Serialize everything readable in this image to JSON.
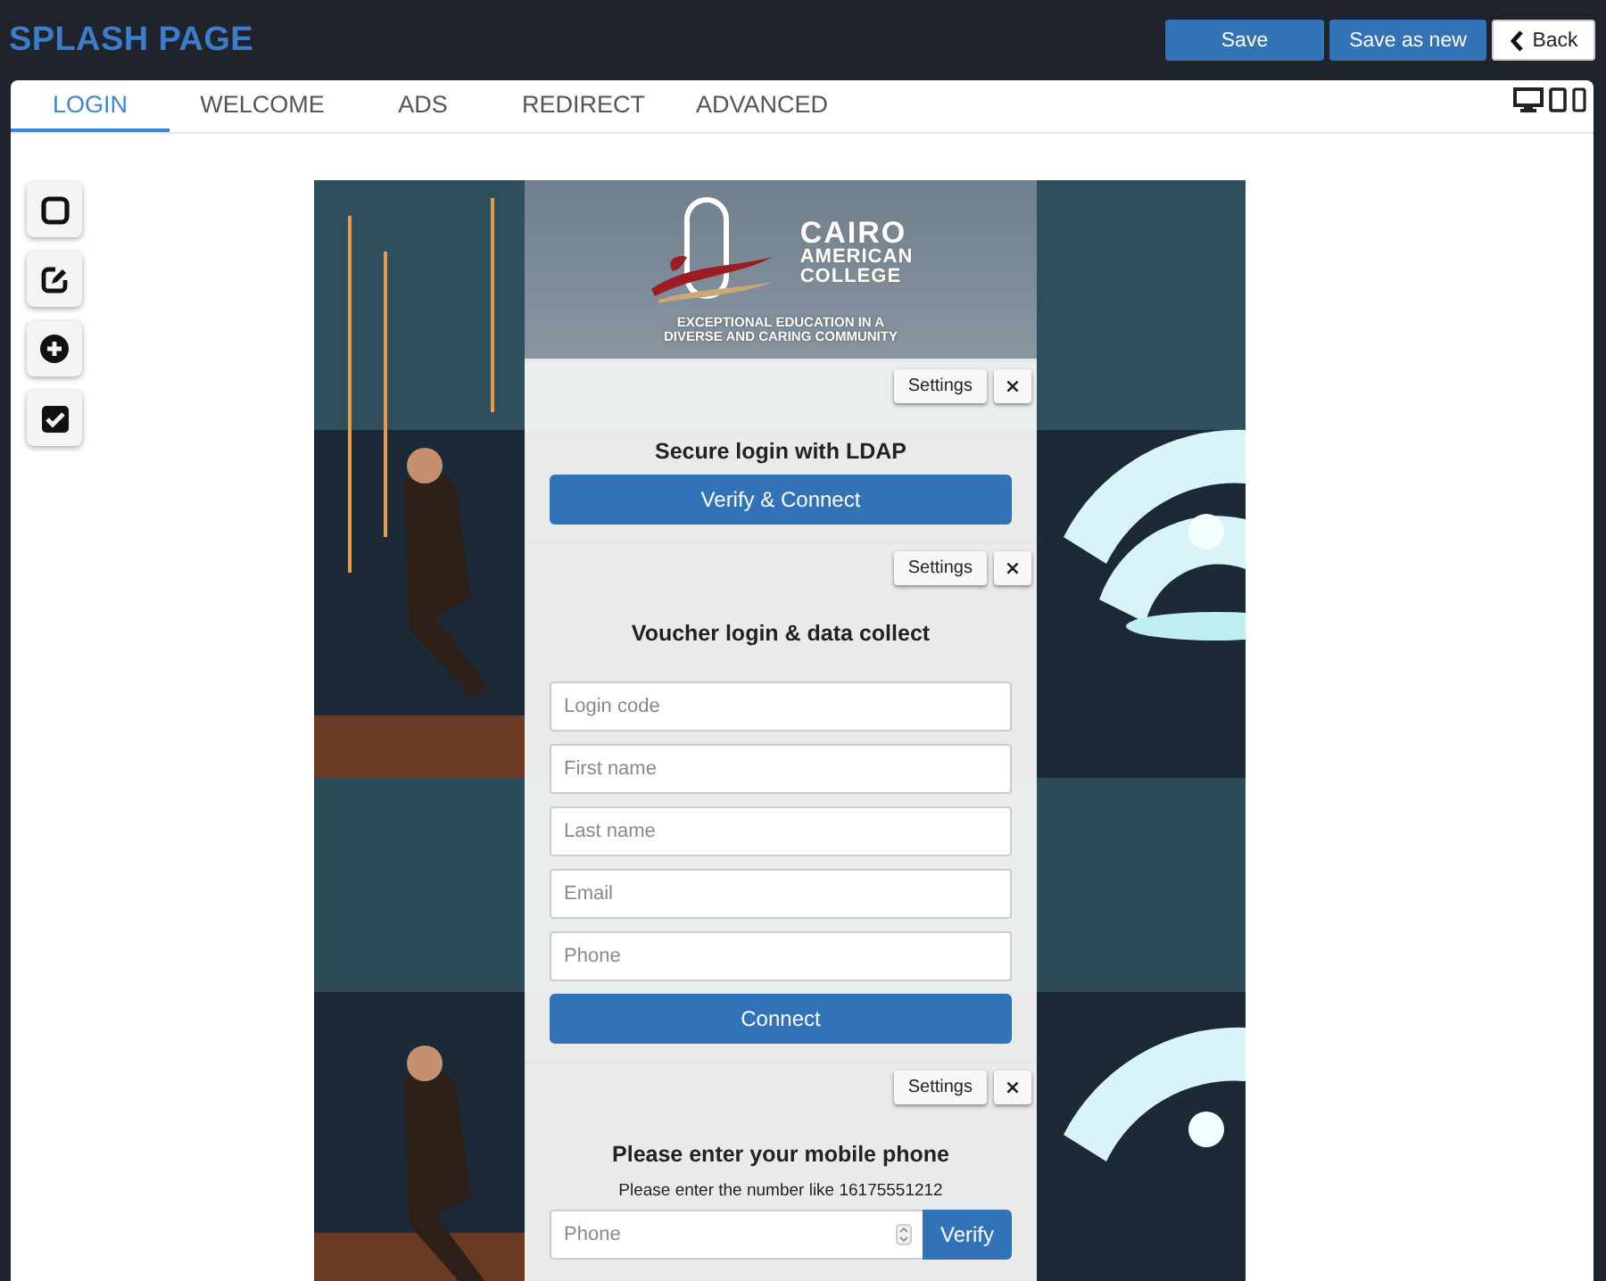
{
  "header": {
    "title": "SPLASH PAGE",
    "buttons": [
      {
        "label": "Save",
        "kind": "primary"
      },
      {
        "label": "Save as new",
        "kind": "primary"
      },
      {
        "label": "Back",
        "kind": "back"
      }
    ]
  },
  "tabs": [
    {
      "label": "LOGIN",
      "selected": true
    },
    {
      "label": "WELCOME",
      "selected": false
    },
    {
      "label": "ADS",
      "selected": false
    },
    {
      "label": "REDIRECT",
      "selected": false
    },
    {
      "label": "ADVANCED",
      "selected": false
    }
  ],
  "logo": {
    "name_lines": [
      "CAIRO",
      "AMERICAN",
      "COLLEGE"
    ],
    "tagline_lines": [
      "EXCEPTIONAL EDUCATION IN A",
      "DIVERSE AND CARING COMMUNITY"
    ]
  },
  "blocks": [
    {
      "kind": "ldap",
      "settings": "Settings",
      "close": "×",
      "heading": "Secure login with LDAP",
      "button": "Verify & Connect"
    },
    {
      "kind": "voucher",
      "settings": "Settings",
      "close": "×",
      "heading": "Voucher login & data collect",
      "fields": [
        {
          "placeholder": "Login code"
        },
        {
          "placeholder": "First name"
        },
        {
          "placeholder": "Last name"
        },
        {
          "placeholder": "Email"
        },
        {
          "placeholder": "Phone"
        }
      ],
      "button": "Connect"
    },
    {
      "kind": "sms",
      "settings": "Settings",
      "close": "×",
      "heading": "Please enter your mobile phone",
      "hint": "Please enter the number like 16175551212",
      "field": {
        "placeholder": "Phone"
      },
      "button": "Verify"
    }
  ]
}
